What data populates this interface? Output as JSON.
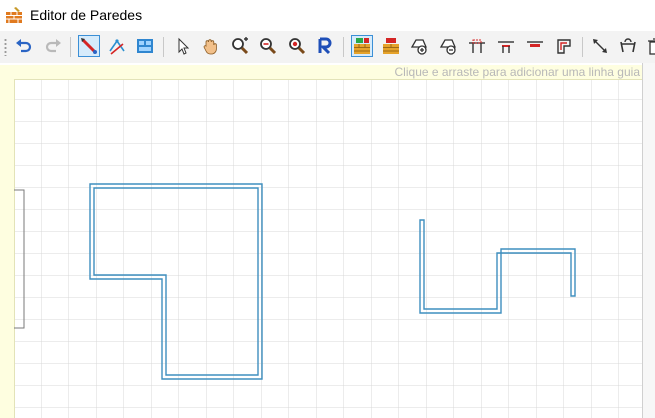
{
  "window": {
    "title": "Editor de Paredes",
    "app_icon": "brick-wall-icon"
  },
  "toolbar": {
    "buttons": [
      {
        "name": "undo-icon",
        "active": false
      },
      {
        "name": "redo-icon",
        "active": false
      },
      {
        "name": "draw-wall-icon",
        "active": true
      },
      {
        "name": "edit-points-icon",
        "active": false
      },
      {
        "name": "import-image-icon",
        "active": false
      },
      {
        "name": "select-pointer-icon",
        "active": false
      },
      {
        "name": "pan-hand-icon",
        "active": false
      },
      {
        "name": "zoom-in-icon",
        "active": false
      },
      {
        "name": "zoom-out-icon",
        "active": false
      },
      {
        "name": "zoom-fit-icon",
        "active": false
      },
      {
        "name": "rotate-r-icon",
        "active": false
      },
      {
        "name": "wall-type-1-icon",
        "active": true
      },
      {
        "name": "wall-type-2-icon",
        "active": false
      },
      {
        "name": "add-point-icon",
        "active": false
      },
      {
        "name": "remove-point-icon",
        "active": false
      },
      {
        "name": "door-icon",
        "active": false
      },
      {
        "name": "window-icon",
        "active": false
      },
      {
        "name": "opening-icon",
        "active": false
      },
      {
        "name": "room-icon",
        "active": false
      },
      {
        "name": "dimension-icon",
        "active": false
      },
      {
        "name": "join-walls-icon",
        "active": false
      },
      {
        "name": "delete-icon",
        "active": false
      }
    ]
  },
  "canvas": {
    "guide_hint": "Clique e arraste para adicionar uma linha guia"
  },
  "colors": {
    "wall": "#3f8fbf",
    "grid": "#d9d9d9",
    "ruler": "#fefee0",
    "active_button_border": "#3b8fd6"
  }
}
